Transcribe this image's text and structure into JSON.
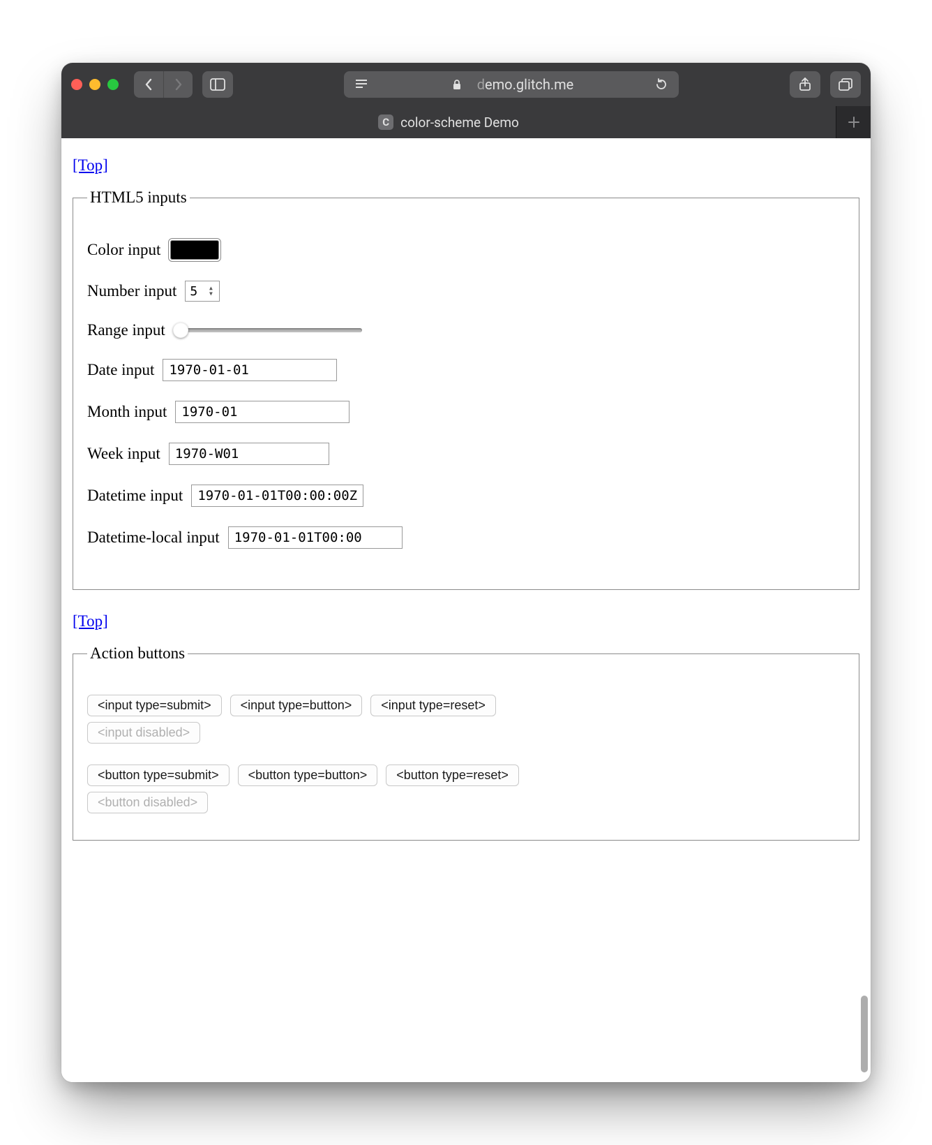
{
  "browser": {
    "url_host": "demo.glitch.me",
    "url_prefix_dim": "d",
    "url_rest": "emo.glitch.me",
    "tab_title": "color-scheme Demo",
    "favicon_letter": "C"
  },
  "links": {
    "top": "[Top]"
  },
  "fieldsets": {
    "inputs_legend": "HTML5 inputs",
    "actions_legend": "Action buttons"
  },
  "inputs": {
    "color": {
      "label": "Color input",
      "value": "#000000"
    },
    "number": {
      "label": "Number input",
      "value": "5"
    },
    "range": {
      "label": "Range input",
      "value": "10"
    },
    "date": {
      "label": "Date input",
      "value": "1970-01-01"
    },
    "month": {
      "label": "Month input",
      "value": "1970-01"
    },
    "week": {
      "label": "Week input",
      "value": "1970-W01"
    },
    "datetime": {
      "label": "Datetime input",
      "value": "1970-01-01T00:00:00Z"
    },
    "datetime_local": {
      "label": "Datetime-local input",
      "value": "1970-01-01T00:00"
    }
  },
  "buttons": {
    "input_submit": "<input type=submit>",
    "input_button": "<input type=button>",
    "input_reset": "<input type=reset>",
    "input_disabled": "<input disabled>",
    "btn_submit": "<button type=submit>",
    "btn_button": "<button type=button>",
    "btn_reset": "<button type=reset>",
    "btn_disabled": "<button disabled>"
  }
}
